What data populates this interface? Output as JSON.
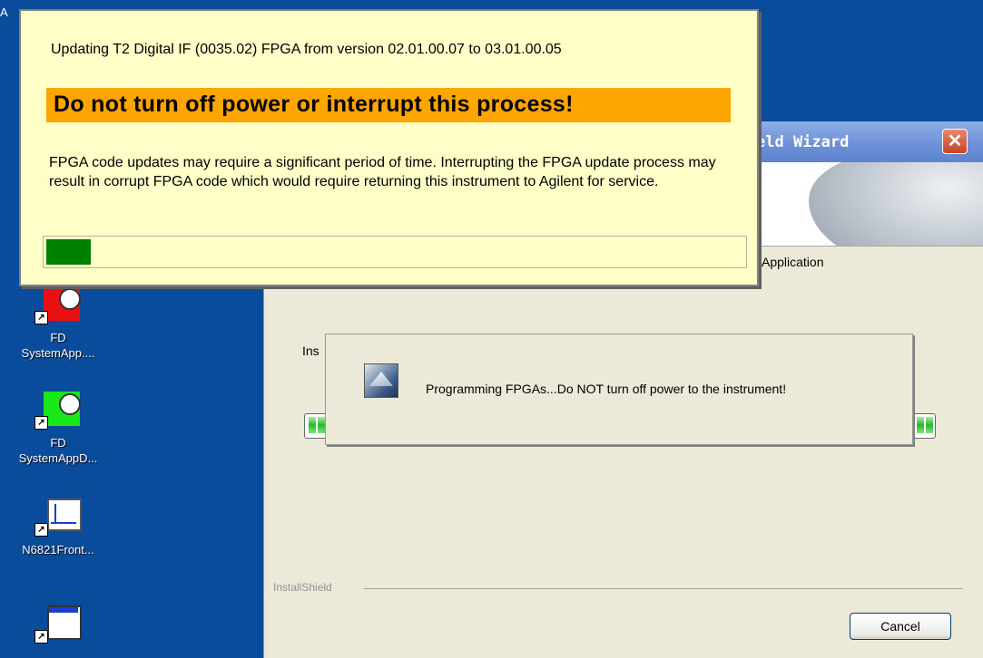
{
  "desktop": {
    "top_letter": "A",
    "icons": [
      {
        "label_line1": "FD",
        "label_line2": "SystemApp....",
        "icon": "clock-app-red-icon",
        "color": "#e81010"
      },
      {
        "label_line1": "FD",
        "label_line2": "SystemAppD...",
        "icon": "clock-app-green-icon",
        "color": "#18e818"
      },
      {
        "label_line1": "N6821Front...",
        "label_line2": "",
        "icon": "spectrum-monitor-icon",
        "color": "#ffffff"
      },
      {
        "label_line1": "",
        "label_line2": "",
        "icon": "window-app-icon",
        "color": "#ffffff"
      }
    ]
  },
  "notice": {
    "line1": "Updating T2 Digital IF (0035.02) FPGA from version 02.01.00.07 to 03.01.00.05",
    "warning": "Do not turn off power or interrupt this process!",
    "body": "FPGA code updates may require a significant period of time. Interrupting the FPGA update process may result in corrupt FPGA code which would require returning this instrument to Agilent for service.",
    "progress_fraction": 0.064,
    "colors": {
      "background": "#ffffc8",
      "warning_bg": "#ffa500",
      "progress": "#008000"
    }
  },
  "wizard": {
    "title_visible": "eld Wizard",
    "subtitle_visible": "Application",
    "instruction_visible": "Ins",
    "installshield_label": "InstallShield",
    "cancel_label": "Cancel",
    "close_symbol": "✕"
  },
  "dialog": {
    "icon": "installshield-icon",
    "message": "Programming FPGAs...Do NOT turn off power to the instrument!"
  }
}
